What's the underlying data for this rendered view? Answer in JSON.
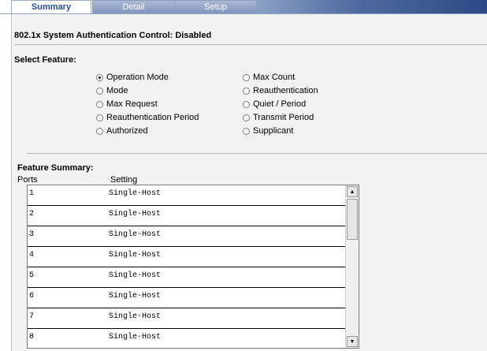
{
  "tabs": [
    {
      "label": "Summary",
      "active": true
    },
    {
      "label": "Detail",
      "active": false
    },
    {
      "label": "Setup",
      "active": false
    }
  ],
  "status_text": "802.1x System Authentication Control: Disabled",
  "select_feature": {
    "title": "Select Feature:",
    "selected": "Operation Mode",
    "left_options": [
      "Operation Mode",
      "Mode",
      "Max Request",
      "Reauthentication Period",
      "Authorized"
    ],
    "right_options": [
      "Max Count",
      "Reauthentication",
      "Quiet / Period",
      "Transmit Period",
      "Supplicant"
    ]
  },
  "feature_summary": {
    "title": "Feature Summary:",
    "columns": [
      "Ports",
      "Setting"
    ],
    "rows": [
      {
        "port": "1",
        "setting": "Single-Host"
      },
      {
        "port": "2",
        "setting": "Single-Host"
      },
      {
        "port": "3",
        "setting": "Single-Host"
      },
      {
        "port": "4",
        "setting": "Single-Host"
      },
      {
        "port": "5",
        "setting": "Single-Host"
      },
      {
        "port": "6",
        "setting": "Single-Host"
      },
      {
        "port": "7",
        "setting": "Single-Host"
      },
      {
        "port": "8",
        "setting": "Single-Host"
      }
    ]
  },
  "icons": {
    "scroll_up": "scroll-up-arrow-icon",
    "scroll_down": "scroll-down-arrow-icon"
  }
}
